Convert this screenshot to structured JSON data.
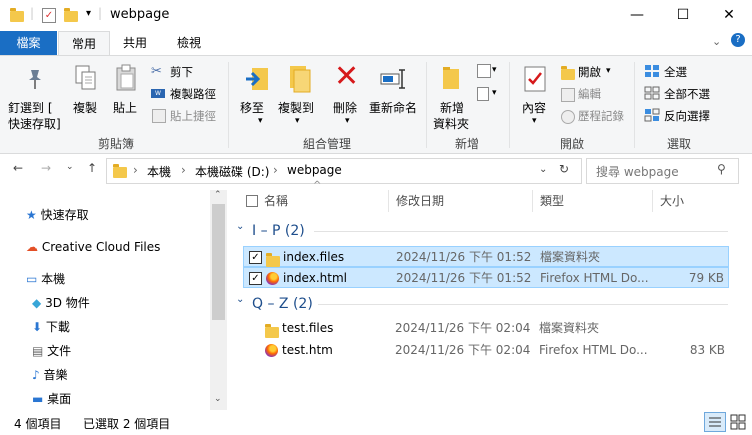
{
  "window": {
    "title": "webpage",
    "controls": {
      "minimize": "—",
      "maximize": "☐",
      "close": "✕"
    }
  },
  "quick_access_toolbar": {
    "dropdown": "▾"
  },
  "ribbon_tabs": {
    "file": "檔案",
    "home": "常用",
    "share": "共用",
    "view": "檢視"
  },
  "ribbon": {
    "clipboard": {
      "group_label": "剪貼簿",
      "pin_line1": "釘選到 [",
      "pin_line2": "快速存取]",
      "copy": "複製",
      "paste": "貼上",
      "cut": "剪下",
      "copy_path": "複製路徑",
      "paste_shortcut": "貼上捷徑"
    },
    "organize": {
      "group_label": "組合管理",
      "move_to": "移至",
      "copy_to": "複製到",
      "delete": "刪除",
      "rename": "重新命名"
    },
    "new": {
      "group_label": "新增",
      "new_folder_line1": "新增",
      "new_folder_line2": "資料夾"
    },
    "open": {
      "group_label": "開啟",
      "properties": "內容",
      "open": "開啟",
      "edit": "編輯",
      "history": "歷程記錄"
    },
    "select": {
      "group_label": "選取",
      "select_all": "全選",
      "select_none": "全部不選",
      "invert": "反向選擇"
    }
  },
  "address_bar": {
    "crumbs": [
      "本機",
      "本機磁碟 (D:)",
      "webpage"
    ],
    "separator": "›",
    "search_placeholder": "搜尋 webpage"
  },
  "nav_pane": {
    "items": [
      {
        "label": "快速存取"
      },
      {
        "label": "Creative Cloud Files"
      },
      {
        "label": "本機"
      },
      {
        "label": "3D 物件"
      },
      {
        "label": "下載"
      },
      {
        "label": "文件"
      },
      {
        "label": "音樂"
      },
      {
        "label": "桌面"
      }
    ]
  },
  "columns": {
    "name": "名稱",
    "date": "修改日期",
    "type": "類型",
    "size": "大小"
  },
  "groups": [
    {
      "label": "I – P (2)",
      "files": [
        {
          "name": "index.files",
          "date": "2024/11/26 下午 01:52",
          "type": "檔案資料夾",
          "size": "",
          "checked": true
        },
        {
          "name": "index.html",
          "date": "2024/11/26 下午 01:52",
          "type": "Firefox HTML Do...",
          "size": "79 KB",
          "checked": true
        }
      ]
    },
    {
      "label": "Q – Z (2)",
      "files": [
        {
          "name": "test.files",
          "date": "2024/11/26 下午 02:04",
          "type": "檔案資料夾",
          "size": ""
        },
        {
          "name": "test.htm",
          "date": "2024/11/26 下午 02:04",
          "type": "Firefox HTML Do...",
          "size": "83 KB"
        }
      ]
    }
  ],
  "status_bar": {
    "item_count": "4 個項目",
    "selected": "已選取 2 個項目"
  },
  "colors": {
    "accent": "#1a6ec4",
    "selection": "#cce8ff",
    "group_header": "#1e4e8c"
  }
}
